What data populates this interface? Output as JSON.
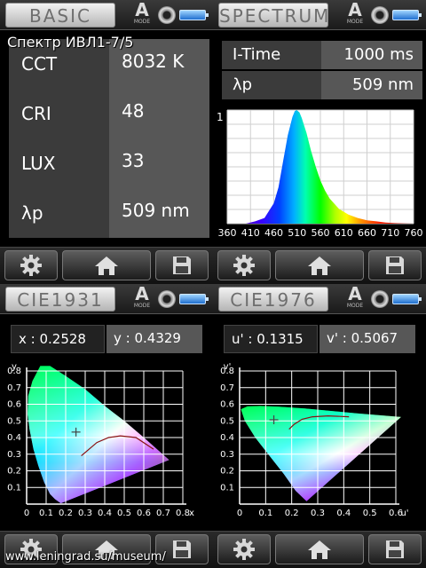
{
  "overlay_title": "Спектр ИВЛ1-7/5",
  "footer_url": "www.leningrad.su/museum/",
  "mode": {
    "letter": "A",
    "word": "MODE"
  },
  "panels": {
    "basic": {
      "title": "BASIC",
      "rows": [
        {
          "label": "CCT",
          "value": "8032 K"
        },
        {
          "label": "CRI",
          "value": "48"
        },
        {
          "label": "LUX",
          "value": "33"
        },
        {
          "label": "λp",
          "value": "509 nm"
        }
      ]
    },
    "spectrum": {
      "title": "SPECTRUM",
      "rows": [
        {
          "label": "I-Time",
          "value": "1000 ms"
        },
        {
          "label": "λp",
          "value": "509 nm"
        }
      ]
    },
    "cie1931": {
      "title": "CIE1931",
      "x_text": "x  :  0.2528",
      "y_text": "y  :  0.4329",
      "axis_x": "x",
      "axis_y": "y"
    },
    "cie1976": {
      "title": "CIE1976",
      "u_text": "u' :  0.1315",
      "v_text": "v' :  0.5067",
      "axis_x": "u'",
      "axis_y": "v'"
    }
  },
  "chart_data": [
    {
      "type": "area",
      "xlabel": "",
      "ylabel": "",
      "xlim": [
        360,
        760
      ],
      "ylim": [
        0,
        1
      ],
      "x_ticks": [
        "360",
        "410",
        "460",
        "510",
        "560",
        "610",
        "660",
        "710",
        "760"
      ],
      "y_tick_labels": [
        "1"
      ],
      "x": [
        360,
        380,
        400,
        420,
        440,
        460,
        470,
        480,
        490,
        500,
        505,
        509,
        515,
        520,
        530,
        540,
        550,
        560,
        570,
        580,
        600,
        620,
        640,
        660,
        680,
        700,
        720,
        740,
        760
      ],
      "values": [
        0.0,
        0.0,
        0.0,
        0.02,
        0.05,
        0.18,
        0.32,
        0.55,
        0.78,
        0.94,
        0.99,
        1.0,
        0.98,
        0.93,
        0.8,
        0.64,
        0.5,
        0.38,
        0.29,
        0.22,
        0.13,
        0.08,
        0.05,
        0.03,
        0.02,
        0.01,
        0.005,
        0.002,
        0.0
      ],
      "grid": true
    },
    {
      "type": "scatter",
      "title": "CIE1931",
      "xlabel": "x",
      "ylabel": "y",
      "xlim": [
        0,
        0.8
      ],
      "ylim": [
        0,
        0.8
      ],
      "x_ticks": [
        "0",
        "0.1",
        "0.2",
        "0.3",
        "0.4",
        "0.5",
        "0.6",
        "0.7",
        "0.8"
      ],
      "y_ticks": [
        "0.1",
        "0.2",
        "0.3",
        "0.4",
        "0.5",
        "0.6",
        "0.7",
        "0.8"
      ],
      "point": {
        "x": 0.2528,
        "y": 0.4329
      },
      "grid": true
    },
    {
      "type": "scatter",
      "title": "CIE1976",
      "xlabel": "u'",
      "ylabel": "v'",
      "xlim": [
        0,
        0.6
      ],
      "ylim": [
        0,
        0.8
      ],
      "x_ticks": [
        "0",
        "0.1",
        "0.2",
        "0.3",
        "0.4",
        "0.5",
        "0.6"
      ],
      "y_ticks": [
        "0.1",
        "0.2",
        "0.3",
        "0.4",
        "0.5",
        "0.6",
        "0.7",
        "0.8"
      ],
      "point": {
        "x": 0.1315,
        "y": 0.5067
      },
      "grid": true
    }
  ]
}
